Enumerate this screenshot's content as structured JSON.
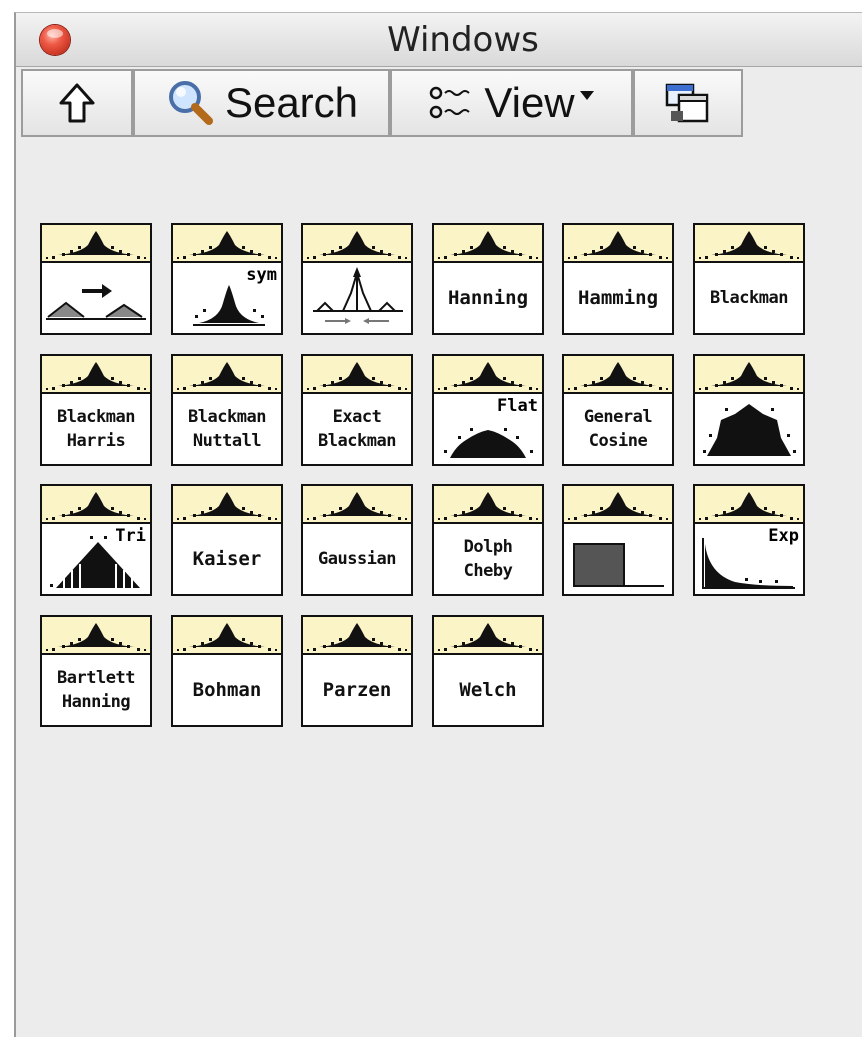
{
  "window": {
    "title": "Windows"
  },
  "toolbar": {
    "up_icon": "up-arrow-icon",
    "search_label": "Search",
    "search_icon": "magnifier-icon",
    "view_label": "View",
    "view_icon": "list-view-icon",
    "view_dropdown_icon": "triangle-down-icon",
    "restore_icon": "window-restore-icon"
  },
  "palette": {
    "items": [
      {
        "label": "",
        "icon": "scaled-time-domain-window-icon"
      },
      {
        "label": "",
        "corner": "sym",
        "icon": "symmetric-window-icon"
      },
      {
        "label": "",
        "icon": "window-properties-icon"
      },
      {
        "label": "Hanning"
      },
      {
        "label": "Hamming"
      },
      {
        "label": "Blackman"
      },
      {
        "label": "Blackman\nHarris"
      },
      {
        "label": "Blackman\nNuttall"
      },
      {
        "label": "Exact\nBlackman"
      },
      {
        "label": "",
        "corner": "Flat",
        "icon": "flat-top-window-icon"
      },
      {
        "label": "General\nCosine"
      },
      {
        "label": "",
        "icon": "modified-bartlett-hanning-icon"
      },
      {
        "label": "",
        "corner": "Tri",
        "icon": "triangle-window-icon"
      },
      {
        "label": "Kaiser"
      },
      {
        "label": "Gaussian"
      },
      {
        "label": "Dolph\nCheby"
      },
      {
        "label": "",
        "icon": "force-window-icon"
      },
      {
        "label": "",
        "corner": "Exp",
        "icon": "exponential-window-icon"
      },
      {
        "label": "Bartlett\nHanning"
      },
      {
        "label": "Bohman"
      },
      {
        "label": "Parzen"
      },
      {
        "label": "Welch"
      }
    ]
  },
  "colors": {
    "banner": "#fbf4c6",
    "window_bg": "#ececec",
    "close_button": "#e0402c"
  }
}
